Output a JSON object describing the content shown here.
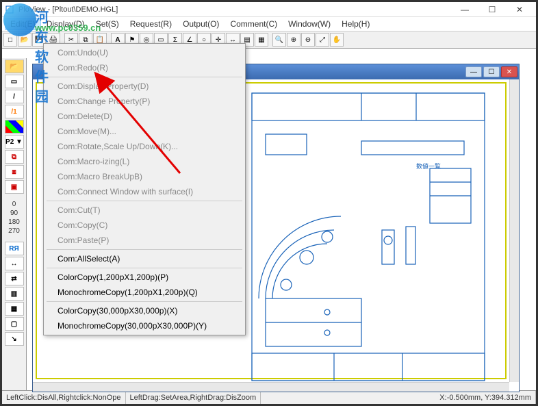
{
  "window": {
    "title": "PloView - [Pltout\\DEMO.HGL]",
    "min": "—",
    "max": "☐",
    "close": "✕"
  },
  "menubar": [
    "Edit(E)",
    "Display(D)",
    "Set(S)",
    "Request(R)",
    "Output(O)",
    "Comment(C)",
    "Window(W)",
    "Help(H)"
  ],
  "menubar_active_index": 0,
  "dropdown": {
    "items": [
      {
        "label": "Com:Undo(U)",
        "enabled": false
      },
      {
        "label": "Com:Redo(R)",
        "enabled": false
      },
      {
        "sep": true
      },
      {
        "label": "Com:Display Property(D)",
        "enabled": false
      },
      {
        "label": "Com:Change Property(P)",
        "enabled": false
      },
      {
        "label": "Com:Delete(D)",
        "enabled": false
      },
      {
        "label": "Com:Move(M)...",
        "enabled": false
      },
      {
        "label": "Com:Rotate,Scale Up/Down(K)...",
        "enabled": false
      },
      {
        "label": "Com:Macro-izing(L)",
        "enabled": false
      },
      {
        "label": "Com:Macro BreakUpB)",
        "enabled": false
      },
      {
        "label": "Com:Connect Window with surface(I)",
        "enabled": false
      },
      {
        "sep": true
      },
      {
        "label": "Com:Cut(T)",
        "enabled": false
      },
      {
        "label": "Com:Copy(C)",
        "enabled": false
      },
      {
        "label": "Com:Paste(P)",
        "enabled": false
      },
      {
        "sep": true
      },
      {
        "label": "Com:AllSelect(A)",
        "enabled": true
      },
      {
        "sep": true
      },
      {
        "label": "ColorCopy(1,200pX1,200p)(P)",
        "enabled": true
      },
      {
        "label": "MonochromeCopy(1,200pX1,200p)(Q)",
        "enabled": true
      },
      {
        "sep": true
      },
      {
        "label": "ColorCopy(30,000pX30,000p)(X)",
        "enabled": true
      },
      {
        "label": "MonochromeCopy(30,000pX30,000P)(Y)",
        "enabled": true
      }
    ]
  },
  "lefttools": {
    "labels": [
      "0",
      "90",
      "180",
      "270"
    ],
    "p2": "P2 ▼",
    "rya": "RЯ"
  },
  "status": {
    "left": "LeftClick:DisAll,Rightclick:NonOpe",
    "mid": "LeftDrag:SetArea,RightDrag:DisZoom",
    "coords": "X:-0.500mm, Y:394.312mm"
  },
  "watermark": {
    "text1": "河东软件园",
    "text2": "www.pc0359.cn"
  },
  "toolbar_icons": [
    "new",
    "open",
    "save",
    "print",
    "|",
    "cut",
    "copy",
    "paste",
    "|",
    "undo",
    "redo",
    "|",
    "text",
    "dim",
    "circle",
    "rect",
    "line",
    "angle",
    "|",
    "move",
    "rot",
    "layer",
    "|",
    "zoom-win",
    "zoom-in",
    "zoom-out",
    "zoom-fit",
    "pan"
  ]
}
